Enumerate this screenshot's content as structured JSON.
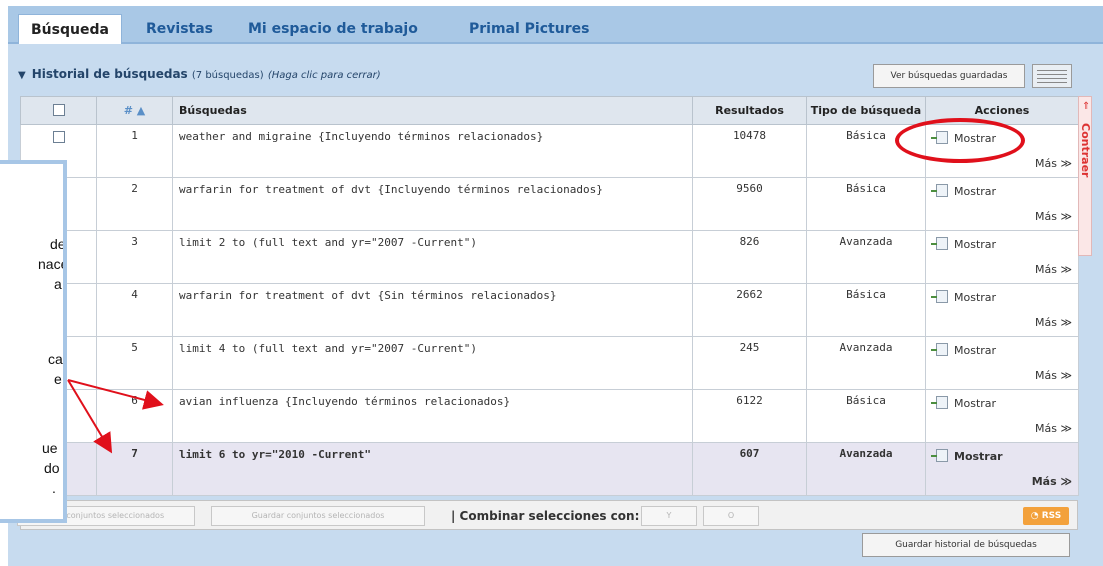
{
  "tabs": [
    {
      "label": "Búsqueda",
      "active": true
    },
    {
      "label": "Revistas",
      "active": false
    },
    {
      "label": "Mi espacio de trabajo",
      "active": false
    },
    {
      "label": "Primal Pictures",
      "active": false
    }
  ],
  "history": {
    "title": "Historial de búsquedas",
    "count": "(7 búsquedas)",
    "hint": "(Haga clic para cerrar)",
    "view_saved_label": "Ver búsquedas guardadas",
    "collapse_label": "Contraer"
  },
  "table": {
    "headers": {
      "num": "# ▲",
      "query": "Búsquedas",
      "results": "Resultados",
      "type": "Tipo de búsqueda",
      "actions": "Acciones"
    },
    "rows": [
      {
        "num": "1",
        "query": "weather and migraine {Incluyendo términos relacionados}",
        "results": "10478",
        "type": "Básica",
        "action": "Mostrar",
        "more": "Más ≫"
      },
      {
        "num": "2",
        "query": "warfarin for treatment of dvt {Incluyendo términos relacionados}",
        "results": "9560",
        "type": "Básica",
        "action": "Mostrar",
        "more": "Más ≫"
      },
      {
        "num": "3",
        "query": "limit 2 to (full text and yr=\"2007 -Current\")",
        "results": "826",
        "type": "Avanzada",
        "action": "Mostrar",
        "more": "Más ≫"
      },
      {
        "num": "4",
        "query": "warfarin for treatment of dvt {Sin términos relacionados}",
        "results": "2662",
        "type": "Básica",
        "action": "Mostrar",
        "more": "Más ≫"
      },
      {
        "num": "5",
        "query": "limit 4 to (full text and yr=\"2007 -Current\")",
        "results": "245",
        "type": "Avanzada",
        "action": "Mostrar",
        "more": "Más ≫"
      },
      {
        "num": "6",
        "query": "avian influenza {Incluyendo términos relacionados}",
        "results": "6122",
        "type": "Básica",
        "action": "Mostrar",
        "more": "Más ≫"
      },
      {
        "num": "7",
        "query": "limit 6 to yr=\"2010 -Current\"",
        "results": "607",
        "type": "Avanzada",
        "action": "Mostrar",
        "more": "Más ≫"
      }
    ]
  },
  "footer": {
    "combine_sets_label": "mar conjuntos seleccionados",
    "save_sets_label": "Guardar conjuntos seleccionados",
    "combine_with_label": "| Combinar selecciones con:",
    "and_label": "Y",
    "or_label": "O",
    "rss_label": "RSS",
    "save_history_label": "Guardar historial de búsquedas"
  },
  "callout": {
    "lines": [
      "de",
      "nace",
      "a",
      "ca",
      "e",
      "ue",
      "do",
      "."
    ]
  }
}
